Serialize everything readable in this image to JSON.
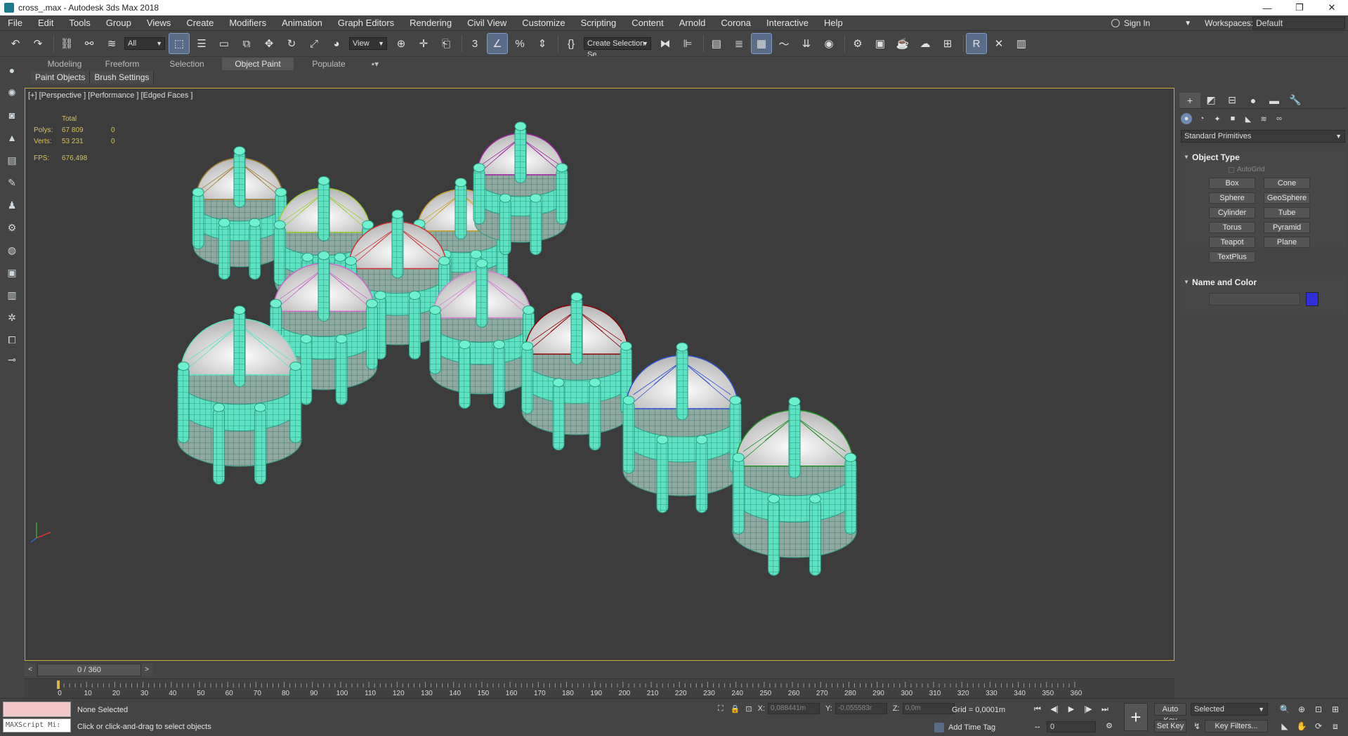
{
  "window": {
    "title": "cross_.max - Autodesk 3ds Max 2018",
    "controls": [
      "—",
      "❐",
      "✕"
    ]
  },
  "menu": {
    "items": [
      "File",
      "Edit",
      "Tools",
      "Group",
      "Views",
      "Create",
      "Modifiers",
      "Animation",
      "Graph Editors",
      "Rendering",
      "Civil View",
      "Customize",
      "Scripting",
      "Content",
      "Arnold",
      "Corona",
      "Interactive",
      "Help"
    ],
    "sign_in": "Sign In",
    "workspaces_label": "Workspaces:",
    "workspace": "Default"
  },
  "toolbar": {
    "selection_filter": "All",
    "ref_coord": "View",
    "named_selection": "Create Selection Se"
  },
  "ribbon": {
    "tabs": [
      "Modeling",
      "Freeform",
      "Selection",
      "Object Paint",
      "Populate"
    ],
    "active_tab": "Object Paint",
    "subtabs": [
      "Paint Objects",
      "Brush Settings"
    ]
  },
  "viewport": {
    "label": "[+] [Perspective ] [Performance ] [Edged Faces ]",
    "stats": {
      "header": "Total",
      "polys_label": "Polys:",
      "polys_total": "67 809",
      "polys_sel": "0",
      "verts_label": "Verts:",
      "verts_total": "53 231",
      "verts_sel": "0",
      "fps_label": "FPS:",
      "fps": "676,498"
    },
    "ring_color": "#5de3c3",
    "gem_colors": [
      "#a07a2c",
      "#9acd32",
      "#c9a227",
      "#a020a0",
      "#cc3333",
      "#cc66cc",
      "#d680d6",
      "#5de3c3",
      "#8b0000",
      "#2b4ecf",
      "#1f8c1f"
    ]
  },
  "command_panel": {
    "dropdown": "Standard Primitives",
    "object_type": {
      "title": "Object Type",
      "autogrid": "AutoGrid",
      "buttons": [
        "Box",
        "Cone",
        "Sphere",
        "GeoSphere",
        "Cylinder",
        "Tube",
        "Torus",
        "Pyramid",
        "Teapot",
        "Plane",
        "TextPlus"
      ]
    },
    "name_color": {
      "title": "Name and Color",
      "swatch": "#3030d8"
    }
  },
  "timeline": {
    "frame_display": "0 / 360",
    "ticks": [
      "0",
      "10",
      "20",
      "30",
      "40",
      "50",
      "60",
      "70",
      "80",
      "90",
      "100",
      "110",
      "120",
      "130",
      "140",
      "150",
      "160",
      "170",
      "180",
      "190",
      "200",
      "210",
      "220",
      "230",
      "240",
      "250",
      "260",
      "270",
      "280",
      "290",
      "300",
      "310",
      "320",
      "330",
      "340",
      "350",
      "360"
    ]
  },
  "status": {
    "maxscript": "MAXScript Mi:",
    "selection": "None Selected",
    "prompt": "Click or click-and-drag to select objects",
    "x_label": "X:",
    "x_value": "0,088441m",
    "y_label": "Y:",
    "y_value": "-0,055583r",
    "z_label": "Z:",
    "z_value": "0,0m",
    "grid": "Grid = 0,0001m",
    "add_time_tag": "Add Time Tag",
    "current_frame": "0",
    "auto_key": "Auto Key",
    "set_key": "Set Key",
    "key_mode": "Selected",
    "key_filters": "Key Filters..."
  }
}
